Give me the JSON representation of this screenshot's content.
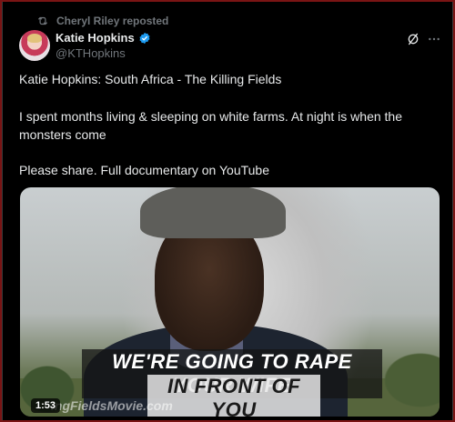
{
  "repost": {
    "text": "Cheryl Riley reposted",
    "icon": "repost-icon"
  },
  "author": {
    "name": "Katie Hopkins",
    "handle": "@KTHopkins",
    "verified_color": "#1d9bf0"
  },
  "actions": {
    "grok_icon": "grok-icon",
    "more_icon": "more-icon"
  },
  "tweet": {
    "line1": "Katie Hopkins: South Africa - The Killing Fields",
    "line2": "I spent months living & sleeping on white farms. At night is when the monsters come",
    "line3": "Please share. Full documentary on YouTube"
  },
  "media": {
    "caption_line1": "WE'RE GOING TO RAPE YOUR WIFE",
    "caption_line2": "IN FRONT OF YOU",
    "watermark": "KillingFieldsMovie.com",
    "watermark_visible": "ingFieldsMovie.com",
    "duration": "1:53"
  },
  "colors": {
    "background": "#000000",
    "text": "#e7e9ea",
    "secondary": "#71767b",
    "accent": "#1d9bf0"
  }
}
